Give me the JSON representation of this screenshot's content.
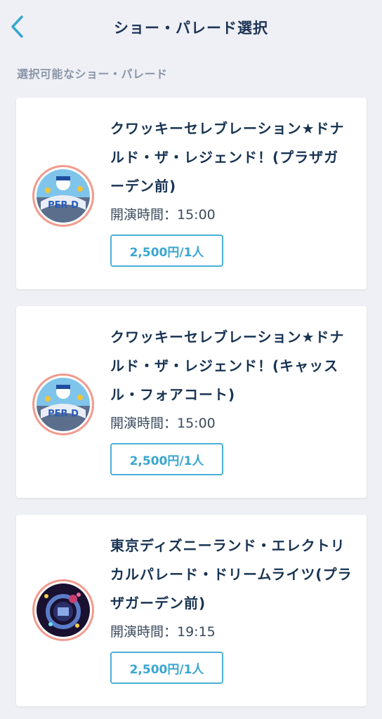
{
  "header": {
    "title": "ショー・パレード選択",
    "back_icon": "chevron-left-icon"
  },
  "section_label": "選択可能なショー・パレード",
  "shows": [
    {
      "name": "クワッキーセレブレーション★ドナルド・ザ・レジェンド！(プラザガーデン前)",
      "time_label": "開演時間：15:00",
      "price": "2,500円/1人",
      "thumb": "donald-parade-thumbnail"
    },
    {
      "name": "クワッキーセレブレーション★ドナルド・ザ・レジェンド！(キャッスル・フォアコート)",
      "time_label": "開演時間：15:00",
      "price": "2,500円/1人",
      "thumb": "donald-parade-thumbnail"
    },
    {
      "name": "東京ディズニーランド・エレクトリカルパレード・ドリームライツ(プラザガーデン前)",
      "time_label": "開演時間：19:15",
      "price": "2,500円/1人",
      "thumb": "electrical-parade-thumbnail"
    }
  ],
  "colors": {
    "accent": "#3aa6d0",
    "title": "#1e3455",
    "thumb_border": "#f29a8c"
  }
}
